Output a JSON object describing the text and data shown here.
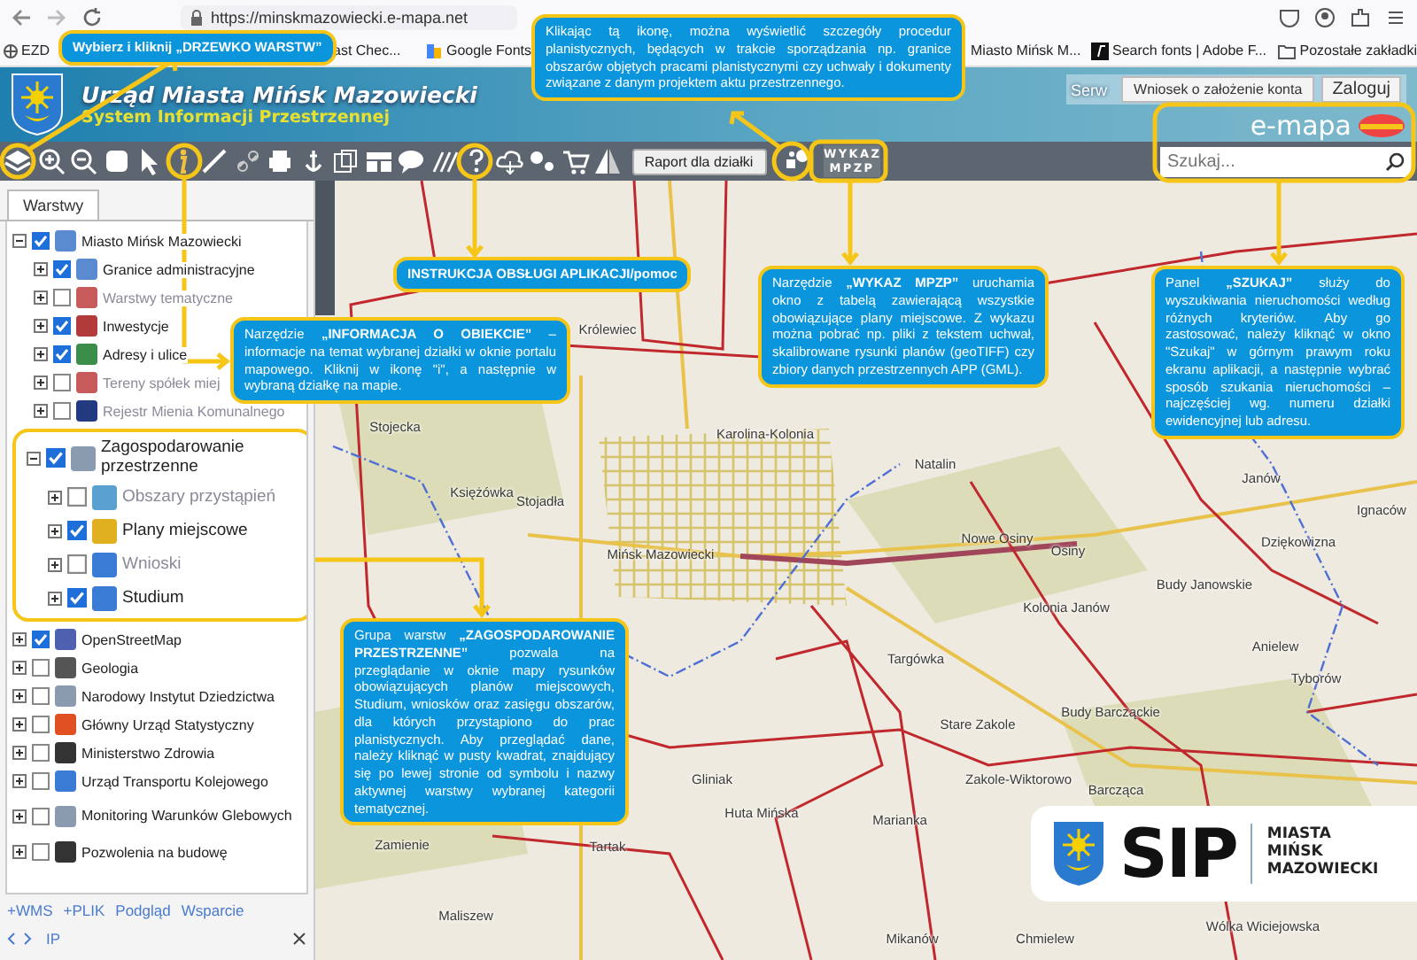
{
  "browser": {
    "url": "https://minskmazowiecki.e-mapa.net",
    "bookmarks": [
      "EZD",
      "ast Chec...",
      "Google Fonts",
      "Miasto Mińsk M...",
      "Search fonts | Adobe F..."
    ],
    "other_bookmarks": "Pozostałe zakładki"
  },
  "header": {
    "title": "Urząd Miasta Mińsk Mazowiecki",
    "subtitle": "System Informacji Przestrzennej",
    "service_link": "Serw",
    "buttons": [
      "Wniosek o założenie konta",
      "Zaloguj"
    ],
    "brand": "e-mapa"
  },
  "toolbar": {
    "report_button": "Raport dla działki",
    "mpzp_button": "WYKAZ MPZP"
  },
  "search": {
    "placeholder": "Szukaj..."
  },
  "layers_panel": {
    "tab": {
      "label": "Warstwy",
      "selected": true
    },
    "tree": [
      {
        "label": "Miasto Mińsk Mazowiecki",
        "checked": true,
        "disabled": false,
        "expanded": true,
        "highlighted": false,
        "children": [
          {
            "label": "Granice administracyjne",
            "checked": true,
            "disabled": false,
            "expanded": false,
            "highlighted": false
          },
          {
            "label": "Warstwy tematyczne",
            "checked": false,
            "disabled": true,
            "expanded": false,
            "highlighted": false
          },
          {
            "label": "Inwestycje",
            "checked": true,
            "disabled": false,
            "expanded": false,
            "highlighted": false
          },
          {
            "label": "Adresy i ulice",
            "checked": true,
            "disabled": false,
            "expanded": false,
            "highlighted": false
          },
          {
            "label": "Tereny spółek miej",
            "checked": false,
            "disabled": true,
            "expanded": false,
            "highlighted": false
          },
          {
            "label": "Rejestr Mienia Komunalnego",
            "checked": false,
            "disabled": true,
            "expanded": false,
            "highlighted": false
          }
        ]
      },
      {
        "label": "Zagospodarowanie przestrzenne",
        "checked": true,
        "disabled": false,
        "expanded": true,
        "highlighted": true,
        "children": [
          {
            "label": "Obszary przystąpień",
            "checked": false,
            "disabled": true,
            "expanded": false,
            "highlighted": false
          },
          {
            "label": "Plany miejscowe",
            "checked": true,
            "disabled": false,
            "expanded": false,
            "highlighted": false
          },
          {
            "label": "Wnioski",
            "checked": false,
            "disabled": true,
            "expanded": false,
            "highlighted": false
          },
          {
            "label": "Studium",
            "checked": true,
            "disabled": false,
            "expanded": false,
            "highlighted": false
          }
        ]
      },
      {
        "label": "OpenStreetMap",
        "checked": true,
        "disabled": false,
        "expanded": false,
        "highlighted": false
      },
      {
        "label": "Geologia",
        "checked": false,
        "disabled": false,
        "expanded": false,
        "highlighted": false
      },
      {
        "label": "Narodowy Instytut Dziedzictwa",
        "checked": false,
        "disabled": false,
        "expanded": false,
        "highlighted": false
      },
      {
        "label": "Główny Urząd Statystyczny",
        "checked": false,
        "disabled": false,
        "expanded": false,
        "highlighted": false
      },
      {
        "label": "Ministerstwo Zdrowia",
        "checked": false,
        "disabled": false,
        "expanded": false,
        "highlighted": false
      },
      {
        "label": "Urząd Transportu Kolejowego",
        "checked": false,
        "disabled": false,
        "expanded": false,
        "highlighted": false
      },
      {
        "label": "Monitoring Warunków Glebowych",
        "checked": false,
        "disabled": false,
        "expanded": false,
        "highlighted": false
      },
      {
        "label": "Pozwolenia na budowę",
        "checked": false,
        "disabled": false,
        "expanded": false,
        "highlighted": false
      }
    ],
    "footer_links": [
      "+WMS",
      "+PLIK",
      "Podgląd",
      "Wsparcie"
    ],
    "status": "IP"
  },
  "map": {
    "places": [
      "Królewiec",
      "Stojecka",
      "Księżówka",
      "Stojadła",
      "Karolina-Kolonia",
      "Natalin",
      "Janów",
      "Ignaców",
      "Mińsk Mazowiecki",
      "Nowe Osiny",
      "Osiny",
      "Dziękowizna",
      "Budy Janowskie",
      "Kolonia Janów",
      "Targówka",
      "Anielew",
      "Tyborów",
      "Stare Zakole",
      "Budy Barcząckie",
      "Zakole-Wiktorowo",
      "Barcząca",
      "Gliniak",
      "Huta Mińska",
      "Marianka",
      "Tartak",
      "Mikanów",
      "Chmielew",
      "Wólka Wiciejowska",
      "Zamienie",
      "Maliszew"
    ]
  },
  "callouts": [
    {
      "text": "Wybierz i kliknij **„DRZEWKO WARSTW”**"
    },
    {
      "text": "Klikając tą ikonę, można wyświetlić szczegóły procedur planistycznych, będących w trakcie sporządzania np. granice obszarów objętych pracami planistycznymi czy uchwały i dokumenty związane z danym projektem aktu przestrzennego."
    },
    {
      "text": "**INSTRUKCJA OBSŁUGI APLIKACJI**/pomoc"
    },
    {
      "text": "Narzędzie **„INFORMACJA O OBIEKCIE”** – informacje na temat wybranej działki w oknie portalu mapowego. Kliknij w ikonę \"i\", a następnie w wybraną działkę na mapie."
    },
    {
      "text": "Narzędzie **„WYKAZ MPZP”** uruchamia okno z tabelą zawierającą wszystkie obowiązujące plany miejscowe. Z wykazu można pobrać np. pliki z tekstem uchwał, skalibrowane rysunki planów (geoTIFF) czy zbiory danych przestrzennych APP (GML)."
    },
    {
      "text": "Panel **„SZUKAJ”** służy do wyszukiwania nieruchomości według różnych kryteriów. Aby go zastosować, należy kliknąć w okno \"Szukaj\" w górnym prawym roku ekranu aplikacji, a następnie wybrać sposób szukania nieruchomości – najczęściej wg. numeru działki ewidencyjnej lub adresu."
    },
    {
      "text": "Grupa warstw **„ZAGOSPODAROWANIE PRZESTRZENNE”** pozwala na przeglądanie w oknie mapy rysunków obowiązujących planów miejscowych, Studium, wniosków oraz zasięgu obszarów, dla których przystąpiono do prac planistycznych. Aby przeglądać dane, należy kliknąć w pusty kwadrat, znajdujący się po lewej stronie od symbolu i nazwy aktywnej warstwy wybranej kategorii tematycznej."
    }
  ],
  "sip_logo": {
    "name": "SIP",
    "lines": [
      "MIASTA",
      "MIŃSK",
      "MAZOWIECKI"
    ]
  }
}
